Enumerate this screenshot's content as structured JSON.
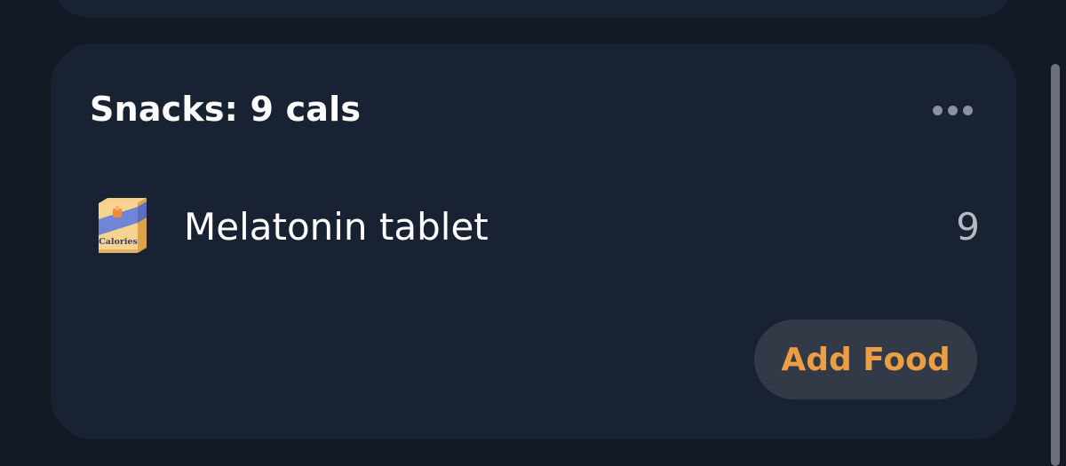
{
  "meal_card": {
    "title": "Snacks: 9 cals",
    "more_icon": "more-horizontal-icon",
    "items": [
      {
        "icon": "calories-box-icon",
        "icon_text": "Calories",
        "name": "Melatonin tablet",
        "calories": "9"
      }
    ],
    "add_food_label": "Add Food"
  },
  "colors": {
    "background": "#131a26",
    "card": "#192233",
    "title": "#ffffff",
    "secondary_text": "#b4b9c2",
    "accent": "#ec9e43",
    "button_bg": "#323947"
  }
}
